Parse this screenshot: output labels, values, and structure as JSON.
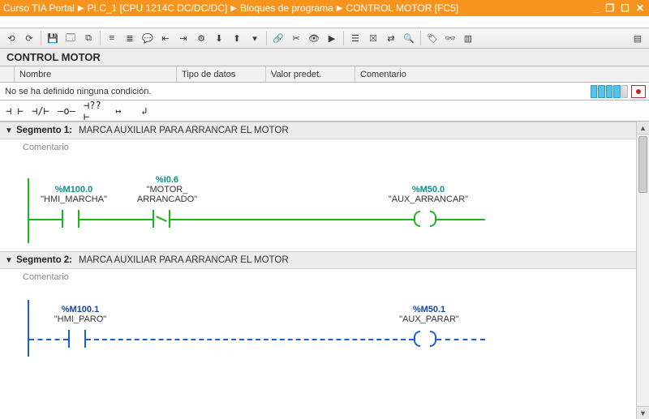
{
  "titlebar": {
    "crumb1": "Curso TIA Portal",
    "crumb2": "PLC_1 [CPU 1214C DC/DC/DC]",
    "crumb3": "Bloques de programa",
    "crumb4": "CONTROL MOTOR [FC5]"
  },
  "block_title": "CONTROL MOTOR",
  "iface_headers": {
    "name": "Nombre",
    "datatype": "Tipo de datos",
    "default": "Valor predet.",
    "comment": "Comentario"
  },
  "condition_bar": {
    "text": "No se ha definido ninguna condición."
  },
  "lad_palette": {
    "no_contact": "⊣ ⊢",
    "nc_contact": "⊣/⊢",
    "coil": "–o–",
    "box": "⊣??⊢",
    "hbranch": "↦",
    "vbranch": "↲"
  },
  "segments": [
    {
      "label": "Segmento 1:",
      "desc": "MARCA AUXILIAR PARA ARRANCAR EL MOTOR",
      "comment": "Comentario",
      "color": "green",
      "elements": {
        "c1_addr": "%M100.0",
        "c1_name": "\"HMI_MARCHA\"",
        "c2_addr": "%I0.6",
        "c2_name_l1": "\"MOTOR_",
        "c2_name_l2": "ARRANCADO\"",
        "coil_addr": "%M50.0",
        "coil_name": "\"AUX_ARRANCAR\""
      }
    },
    {
      "label": "Segmento 2:",
      "desc": "MARCA AUXILIAR PARA ARRANCAR EL MOTOR",
      "comment": "Comentario",
      "color": "blue",
      "elements": {
        "c1_addr": "%M100.1",
        "c1_name": "\"HMI_PARO\"",
        "coil_addr": "%M50.1",
        "coil_name": "\"AUX_PARAR\""
      }
    }
  ]
}
